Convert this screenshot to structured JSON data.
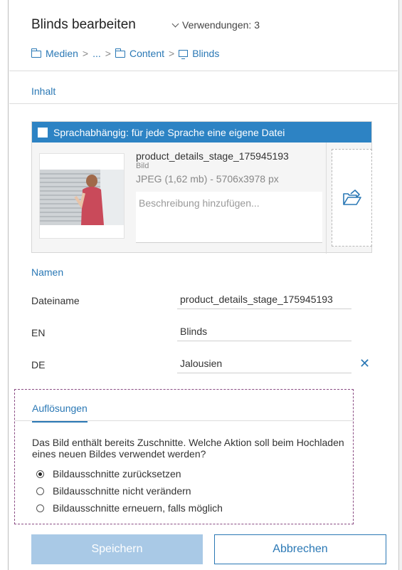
{
  "dialog": {
    "title": "Blinds bearbeiten",
    "usage_label": "Verwendungen: 3"
  },
  "breadcrumb": {
    "items": [
      "Medien",
      "...",
      "Content",
      "Blinds"
    ],
    "separator": ">"
  },
  "tabs": {
    "active": "Inhalt"
  },
  "file": {
    "language_toggle_label": "Sprachabhängig: für jede Sprache eine eigene Datei",
    "language_dependent": false,
    "name": "product_details_stage_175945193",
    "type": "Bild",
    "meta": "JPEG (1,62 mb) - 5706x3978 px",
    "description_placeholder": "Beschreibung hinzufügen..."
  },
  "names": {
    "section_title": "Namen",
    "rows": [
      {
        "label": "Dateiname",
        "value": "product_details_stage_175945193"
      },
      {
        "label": "EN",
        "value": "Blinds"
      },
      {
        "label": "DE",
        "value": "Jalousien"
      }
    ]
  },
  "resolutions": {
    "tab_label": "Auflösungen",
    "question": "Das Bild enthält bereits Zuschnitte. Welche Aktion soll beim Hochladen eines neuen Bildes verwendet werden?",
    "options": [
      {
        "label": "Bildausschnitte zurücksetzen",
        "checked": true
      },
      {
        "label": "Bildausschnitte nicht verändern",
        "checked": false
      },
      {
        "label": "Bildausschnitte erneuern, falls möglich",
        "checked": false
      }
    ]
  },
  "footer": {
    "save_label": "Speichern",
    "cancel_label": "Abbrechen"
  },
  "colors": {
    "accent": "#2a78b5",
    "lang_bar": "#2d83c4",
    "save_disabled": "#a9c9e6",
    "highlight_border": "#8a4b83"
  }
}
